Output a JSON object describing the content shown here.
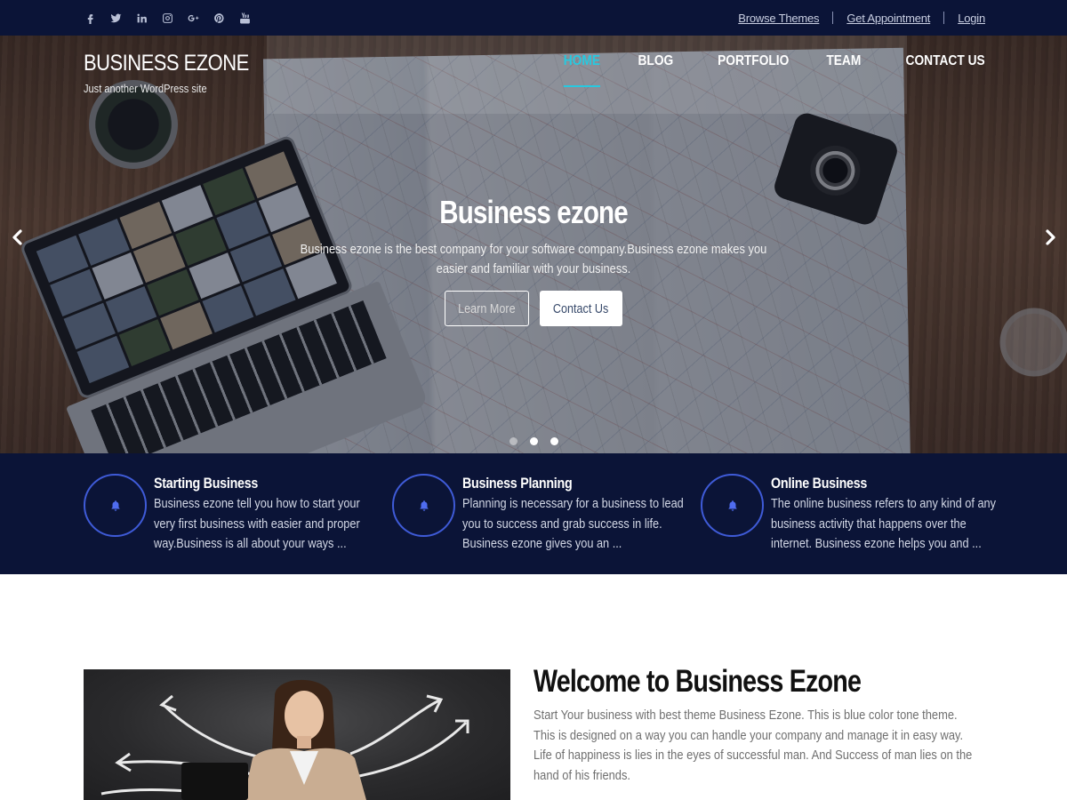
{
  "topbar": {
    "social_icons": [
      "facebook-icon",
      "twitter-icon",
      "linkedin-icon",
      "instagram-icon",
      "google-plus-icon",
      "pinterest-icon",
      "youtube-icon"
    ],
    "links": {
      "browse_themes": "Browse Themes",
      "get_appointment": "Get Appointment",
      "login": "Login"
    }
  },
  "brand": {
    "title": "BUSINESS EZONE",
    "tagline": "Just another WordPress site"
  },
  "nav": {
    "items": [
      {
        "label": "HOME",
        "active": true
      },
      {
        "label": "BLOG",
        "active": false
      },
      {
        "label": "PORTFOLIO",
        "active": false
      },
      {
        "label": "TEAM",
        "active": false
      },
      {
        "label": "CONTACT US",
        "active": false
      }
    ]
  },
  "hero": {
    "title": "Business ezone",
    "description": "Business ezone is the best company for your software company.Business ezone makes you easier and familiar with your business.",
    "learn_more": "Learn More",
    "contact_us": "Contact Us",
    "slides": 3,
    "active_slide": 2
  },
  "features": [
    {
      "title": "Starting Business",
      "text": "Business ezone tell you how to start your very first business with easier and proper way.Business is all about your ways ...",
      "icon": "bell-icon"
    },
    {
      "title": "Business Planning",
      "text": "Planning is necessary for a business to lead you to success and grab success in life. Business ezone gives you an ...",
      "icon": "bell-icon"
    },
    {
      "title": "Online Business",
      "text": "The online business refers to any kind of any business activity that happens over the internet. Business ezone helps you and ...",
      "icon": "bell-icon"
    }
  ],
  "welcome": {
    "title": "Welcome to Business Ezone",
    "text": "Start Your business with best theme Business Ezone. This is blue color tone theme. This is designed on a way you can handle your company and manage it in easy way. Life of happiness is lies in the eyes of successful man. And Success of man lies on the hand of his friends."
  },
  "colors": {
    "navy": "#0b1437",
    "accent": "#27c9e0",
    "feature_ring": "#3f5bd8"
  }
}
